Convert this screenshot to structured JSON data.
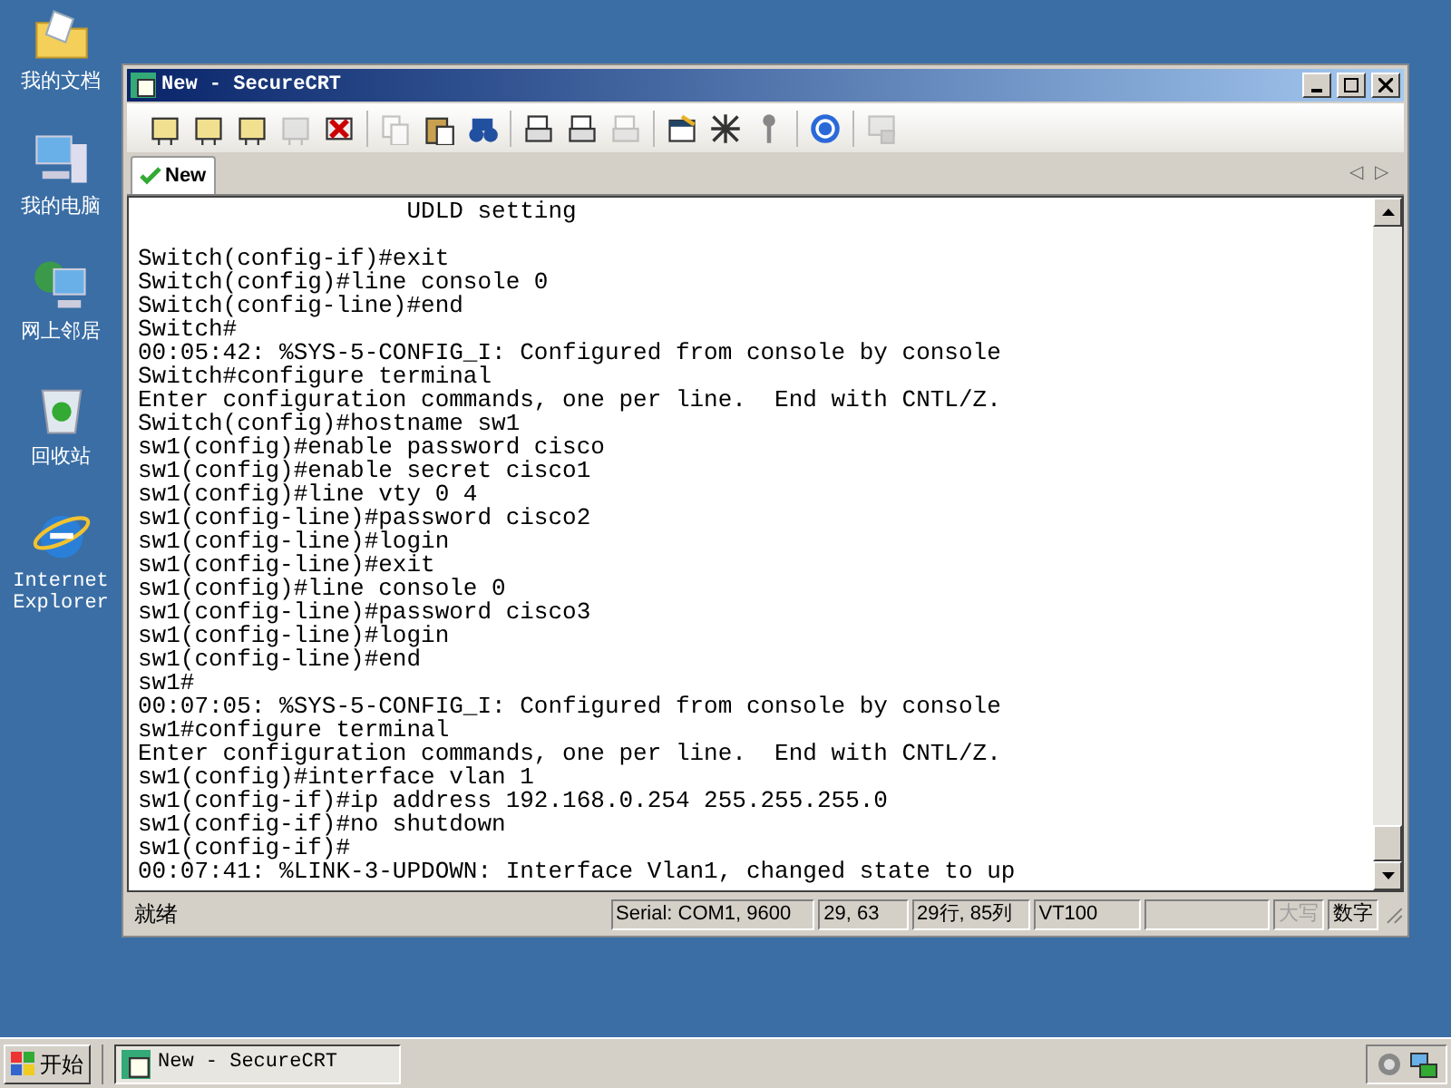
{
  "desktop_icons": [
    {
      "kind": "folder",
      "label": "我的文档"
    },
    {
      "kind": "computer",
      "label": "我的电脑"
    },
    {
      "kind": "network",
      "label": "网上邻居"
    },
    {
      "kind": "recycle",
      "label": "回收站"
    },
    {
      "kind": "ie",
      "label": "Internet Explorer"
    }
  ],
  "window": {
    "title": "New - SecureCRT"
  },
  "toolbar": [
    [
      {
        "kind": "connect",
        "disabled": false
      },
      {
        "kind": "quick",
        "disabled": false
      },
      {
        "kind": "tab",
        "disabled": false
      },
      {
        "kind": "reconnect",
        "disabled": true
      },
      {
        "kind": "disconnect",
        "disabled": false
      }
    ],
    [
      {
        "kind": "copy",
        "disabled": true
      },
      {
        "kind": "paste",
        "disabled": false
      },
      {
        "kind": "find",
        "disabled": false
      }
    ],
    [
      {
        "kind": "print",
        "disabled": false
      },
      {
        "kind": "print",
        "disabled": false
      },
      {
        "kind": "printer",
        "disabled": true
      }
    ],
    [
      {
        "kind": "options",
        "disabled": false
      },
      {
        "kind": "map",
        "disabled": false
      },
      {
        "kind": "key",
        "disabled": false
      }
    ],
    [
      {
        "kind": "help",
        "disabled": false
      }
    ],
    [
      {
        "kind": "lock",
        "disabled": true
      }
    ]
  ],
  "tabs": [
    {
      "label": "New",
      "selected": true
    }
  ],
  "tab_scroll": [
    "◁",
    "▷"
  ],
  "terminal": {
    "blocks": [
      [
        "                   UDLD setting"
      ],
      [
        "Switch(config-if)#exit",
        "Switch(config)#line console 0",
        "Switch(config-line)#end",
        "Switch#",
        "00:05:42: %SYS-5-CONFIG_I: Configured from console by console",
        "Switch#configure terminal",
        "Enter configuration commands, one per line.  End with CNTL/Z.",
        "Switch(config)#hostname sw1",
        "sw1(config)#enable password cisco",
        "sw1(config)#enable secret cisco1",
        "sw1(config)#line vty 0 4",
        "sw1(config-line)#password cisco2",
        "sw1(config-line)#login",
        "sw1(config-line)#exit",
        "sw1(config)#line console 0",
        "sw1(config-line)#password cisco3",
        "sw1(config-line)#login",
        "sw1(config-line)#end",
        "sw1#",
        "00:07:05: %SYS-5-CONFIG_I: Configured from console by console",
        "sw1#configure terminal",
        "Enter configuration commands, one per line.  End with CNTL/Z.",
        "sw1(config)#interface vlan 1",
        "sw1(config-if)#ip address 192.168.0.254 255.255.255.0",
        "sw1(config-if)#no shutdown",
        "sw1(config-if)#",
        "00:07:41: %LINK-3-UPDOWN: Interface Vlan1, changed state to up"
      ]
    ]
  },
  "status_bar": {
    "message": "就绪",
    "panes": [
      {
        "text": "Serial: COM1, 9600",
        "disabled": false
      },
      {
        "text": "29,  63",
        "disabled": false
      },
      {
        "text": "29行, 85列",
        "disabled": false
      },
      {
        "text": "VT100",
        "disabled": false
      },
      {
        "text": "大写",
        "disabled": true
      },
      {
        "text": "数字",
        "disabled": false
      }
    ]
  },
  "taskbar": {
    "start": "开始",
    "tasks": [
      {
        "label": "New - SecureCRT",
        "selected": true
      }
    ]
  }
}
